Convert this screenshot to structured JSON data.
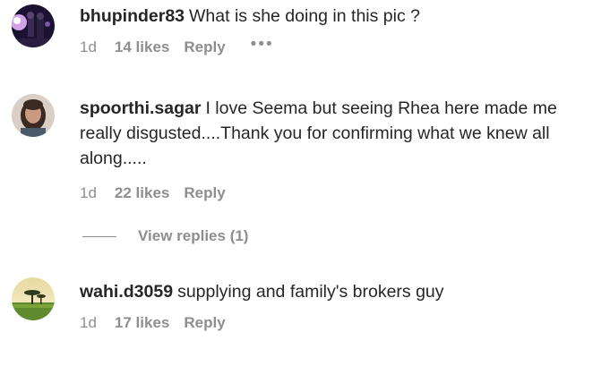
{
  "comments": [
    {
      "username": "bhupinder83",
      "text": "What is she doing in this pic ?",
      "time": "1d",
      "likes": "14 likes",
      "reply": "Reply",
      "more": "•••",
      "avatar_icon": "concert-photo-avatar"
    },
    {
      "username": "spoorthi.sagar",
      "text": "I love Seema but seeing Rhea here made me really disgusted....Thank you for confirming what we knew all along.....",
      "time": "1d",
      "likes": "22 likes",
      "reply": "Reply",
      "avatar_icon": "portrait-avatar"
    },
    {
      "username": "wahi.d3059",
      "text": "supplying and family's brokers guy",
      "time": "1d",
      "likes": "17 likes",
      "reply": "Reply",
      "avatar_icon": "landscape-tree-avatar"
    }
  ],
  "view_replies": "View replies (1)",
  "colors": {
    "text": "#262626",
    "muted": "#8e8e8e",
    "background": "#ffffff"
  }
}
